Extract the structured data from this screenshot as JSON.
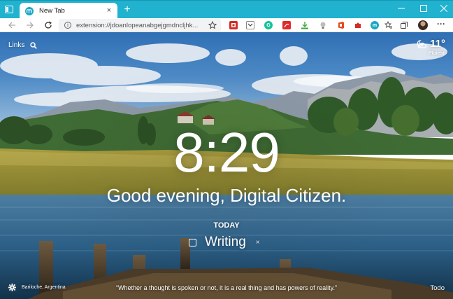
{
  "browser": {
    "tab": {
      "title": "New Tab",
      "close": "×"
    },
    "new_tab": "+",
    "address": {
      "url": "extension://jdoanlopeanabgejgmdncljhk..."
    },
    "extensions": [
      {
        "name": "lastpass-icon",
        "color": "#d32d27",
        "glyph": ""
      },
      {
        "name": "pocket-icon",
        "color": "#ffffff",
        "glyph": ""
      },
      {
        "name": "grammarly-icon",
        "color": "#15c39a",
        "glyph": "G"
      },
      {
        "name": "pdf-icon",
        "color": "#e02a2a",
        "glyph": ""
      },
      {
        "name": "download-icon",
        "color": "#3da63d",
        "glyph": ""
      },
      {
        "name": "lightbulb-icon",
        "color": "#7a7a7a",
        "glyph": ""
      },
      {
        "name": "office-icon",
        "color": "#e64a19",
        "glyph": ""
      },
      {
        "name": "puzzle-icon",
        "color": "#777777",
        "glyph": ""
      },
      {
        "name": "momentum-icon",
        "color": "#1aa8c4",
        "glyph": "m"
      }
    ]
  },
  "momentum": {
    "links_label": "Links",
    "weather": {
      "temp": "11°",
      "city": "Ploiesti"
    },
    "clock": "8:29",
    "greeting": "Good evening, Digital Citizen.",
    "focus": {
      "heading": "TODAY",
      "task": "Writing",
      "remove": "×"
    },
    "photo_location": "Bariloche, Argentina",
    "quote": "“Whether a thought is spoken or not, it is a real thing and has powers of reality.”",
    "todo_label": "Todo"
  },
  "colors": {
    "accent": "#20b2cf",
    "text_on_photo": "#ffffff"
  }
}
